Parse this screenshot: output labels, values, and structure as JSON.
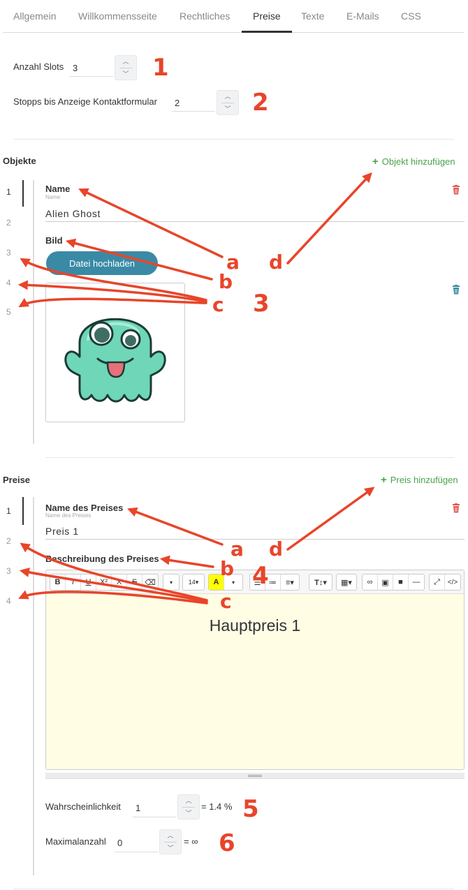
{
  "tabs": [
    {
      "label": "Allgemein"
    },
    {
      "label": "Willkommensseite"
    },
    {
      "label": "Rechtliches"
    },
    {
      "label": "Preise",
      "active": true
    },
    {
      "label": "Texte"
    },
    {
      "label": "E-Mails"
    },
    {
      "label": "CSS"
    }
  ],
  "settings": {
    "slots_label": "Anzahl Slots",
    "slots_value": "3",
    "stops_label": "Stopps bis Anzeige Kontaktformular",
    "stops_value": "2"
  },
  "objects": {
    "heading": "Objekte",
    "add_label": "Objekt hinzufügen",
    "indices": [
      "1",
      "2",
      "3",
      "4",
      "5"
    ],
    "name_label": "Name",
    "name_sub": "Name",
    "name_value": "Alien Ghost",
    "image_label": "Bild",
    "upload_label": "Datei hochladen"
  },
  "prizes": {
    "heading": "Preise",
    "add_label": "Preis hinzufügen",
    "indices": [
      "1",
      "2",
      "3",
      "4"
    ],
    "name_label": "Name des Preises",
    "name_sub": "Name des Preises",
    "name_value": "Preis 1",
    "desc_label": "Beschreibung des Preises",
    "editor_content": "Hauptpreis 1",
    "toolbar": {
      "font_size": "14"
    },
    "probability_label": "Wahrscheinlichkeit",
    "probability_value": "1",
    "probability_result": "= 1.4 %",
    "max_label": "Maximalanzahl",
    "max_value": "0",
    "max_result": "= ∞"
  },
  "annotations": {
    "numbers": [
      "1",
      "2",
      "3",
      "4",
      "5",
      "6"
    ],
    "objects_letters": [
      "a",
      "b",
      "c",
      "d"
    ],
    "prizes_letters": [
      "a",
      "b",
      "c",
      "d"
    ]
  },
  "colors": {
    "accent_green": "#4aa24a",
    "upload_button": "#3a8aa5",
    "trash_red": "#e05a4f",
    "trash_blue": "#3a8aa5",
    "annotation_red": "#e8452a",
    "editor_background": "#fffde4"
  },
  "icons": {
    "add": "plus-icon",
    "delete": "trash-icon",
    "ghost_image": "alien-ghost-image"
  }
}
